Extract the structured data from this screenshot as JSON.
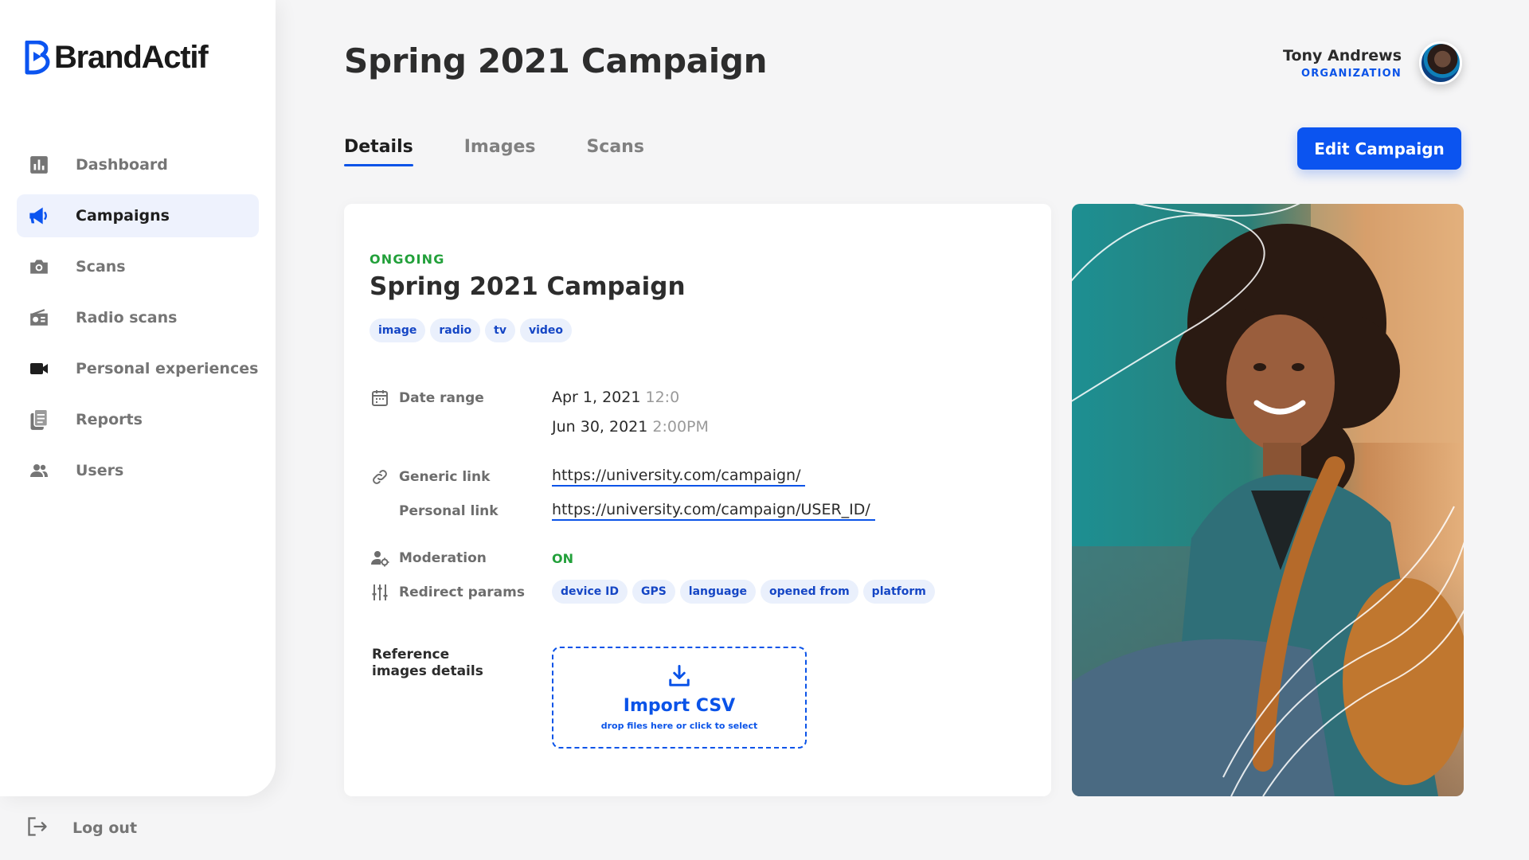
{
  "brand": {
    "name": "BrandActif",
    "accent": "#0b54f0",
    "success": "#22a03a"
  },
  "sidebar": {
    "items": [
      {
        "label": "Dashboard",
        "icon": "bar-chart-icon",
        "active": false
      },
      {
        "label": "Campaigns",
        "icon": "megaphone-icon",
        "active": true
      },
      {
        "label": "Scans",
        "icon": "camera-icon",
        "active": false
      },
      {
        "label": "Radio scans",
        "icon": "radio-icon",
        "active": false
      },
      {
        "label": "Personal experiences",
        "icon": "video-camera-icon",
        "active": false
      },
      {
        "label": "Reports",
        "icon": "documents-icon",
        "active": false
      },
      {
        "label": "Users",
        "icon": "users-icon",
        "active": false
      }
    ],
    "logout_label": "Log out"
  },
  "header": {
    "title": "Spring 2021 Campaign",
    "user": {
      "name": "Tony Andrews",
      "role": "ORGANIZATION"
    }
  },
  "tabs": [
    {
      "label": "Details",
      "active": true
    },
    {
      "label": "Images",
      "active": false
    },
    {
      "label": "Scans",
      "active": false
    }
  ],
  "edit_button_label": "Edit Campaign",
  "details": {
    "status": "ONGOING",
    "title": "Spring 2021 Campaign",
    "channels": [
      "image",
      "radio",
      "tv",
      "video"
    ],
    "date_range": {
      "label": "Date range",
      "start_date": "Apr 1, 2021",
      "start_time": "12:0",
      "end_date": "Jun 30, 2021",
      "end_time": "2:00PM"
    },
    "generic_link": {
      "label": "Generic link",
      "value": "https://university.com/campaign/"
    },
    "personal_link": {
      "label": "Personal link",
      "value": "https://university.com/campaign/USER_ID/"
    },
    "moderation": {
      "label": "Moderation",
      "value": "ON"
    },
    "redirect_params": {
      "label": "Redirect params",
      "values": [
        "device ID",
        "GPS",
        "language",
        "opened from",
        "platform"
      ]
    },
    "reference": {
      "label": "Reference images details",
      "import_title": "Import CSV",
      "import_hint": "drop files here or click to select"
    }
  }
}
